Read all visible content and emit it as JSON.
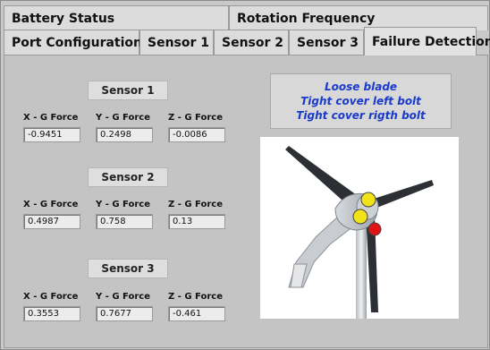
{
  "tabs_row1": [
    {
      "label": "Battery Status"
    },
    {
      "label": "Rotation Frequency"
    }
  ],
  "tabs_row2": [
    {
      "label": "Port Configuration"
    },
    {
      "label": "Sensor 1"
    },
    {
      "label": "Sensor 2"
    },
    {
      "label": "Sensor 3"
    },
    {
      "label": "Failure Detection",
      "active": true
    }
  ],
  "sensors": [
    {
      "title": "Sensor 1",
      "labels": [
        "X - G Force",
        "Y - G Force",
        "Z - G Force"
      ],
      "values": [
        "-0.9451",
        "0.2498",
        "-0.0086"
      ]
    },
    {
      "title": "Sensor 2",
      "labels": [
        "X - G Force",
        "Y - G Force",
        "Z - G Force"
      ],
      "values": [
        "0.4987",
        "0.758",
        "0.13"
      ]
    },
    {
      "title": "Sensor 3",
      "labels": [
        "X - G Force",
        "Y - G Force",
        "Z - G Force"
      ],
      "values": [
        "0.3553",
        "0.7677",
        "-0.461"
      ]
    }
  ],
  "failures": [
    "Loose blade",
    "Tight cover left bolt",
    "Tight cover rigth bolt"
  ],
  "colors": {
    "failure_text": "#1a3ac9",
    "marker_warning": "#f2e21a",
    "marker_error": "#e01414"
  },
  "image": {
    "subject": "wind-turbine"
  }
}
